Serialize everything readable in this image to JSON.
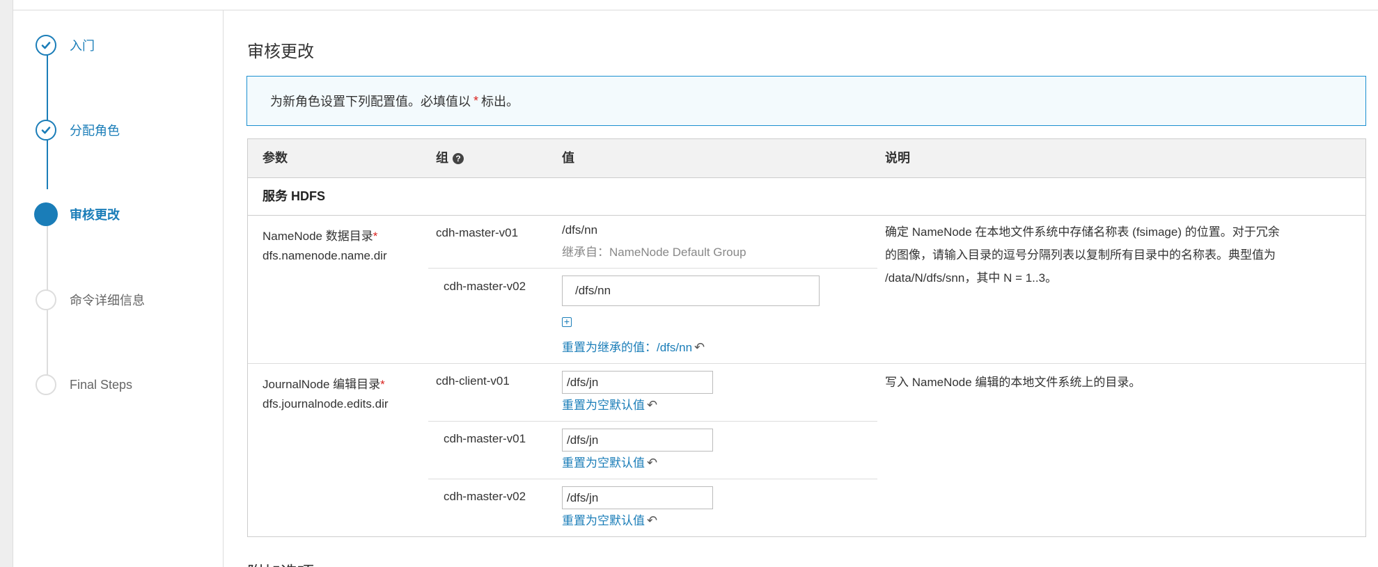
{
  "sidebar": {
    "steps": [
      {
        "label": "入门",
        "state": "done"
      },
      {
        "label": "分配角色",
        "state": "done"
      },
      {
        "label": "审核更改",
        "state": "active"
      },
      {
        "label": "命令详细信息",
        "state": "todo"
      },
      {
        "label": "Final Steps",
        "state": "todo"
      }
    ]
  },
  "page": {
    "title": "审核更改",
    "info_prefix": "为新角色设置下列配置值。必填值以",
    "info_star": "*",
    "info_suffix": "标出。",
    "next_section_peek": "附加选项"
  },
  "table": {
    "headers": {
      "param": "参数",
      "group": "组",
      "value": "值",
      "desc": "说明"
    },
    "section": "服务 HDFS",
    "rows": [
      {
        "param_name": "NameNode 数据目录",
        "required": "*",
        "param_key": "dfs.namenode.name.dir",
        "description": "确定 NameNode 在本地文件系统中存储名称表 (fsimage) 的位置。对于冗余的图像，请输入目录的逗号分隔列表以复制所有目录中的名称表。典型值为 /data/N/dfs/snn，其中 N = 1..3。",
        "groups": [
          {
            "group": "cdh-master-v01",
            "value": "/dfs/nn",
            "inherited": "继承自：NameNode Default Group"
          },
          {
            "group": "cdh-master-v02",
            "value": "/dfs/nn",
            "reset": "重置为继承的值：/dfs/nn"
          }
        ]
      },
      {
        "param_name": "JournalNode 编辑目录",
        "required": "*",
        "param_key": "dfs.journalnode.edits.dir",
        "description": "写入 NameNode 编辑的本地文件系统上的目录。",
        "groups": [
          {
            "group": "cdh-client-v01",
            "value": "/dfs/jn",
            "reset": "重置为空默认值"
          },
          {
            "group": "cdh-master-v01",
            "value": "/dfs/jn",
            "reset": "重置为空默认值"
          },
          {
            "group": "cdh-master-v02",
            "value": "/dfs/jn",
            "reset": "重置为空默认值"
          }
        ]
      }
    ]
  },
  "icons": {
    "check": "check-icon",
    "help": "question-circle-icon",
    "undo": "undo-arrow-icon",
    "add": "plus-square-icon"
  },
  "colors": {
    "accent": "#1a7db8",
    "required": "#d9231f",
    "info_bg": "#f3fafd"
  }
}
